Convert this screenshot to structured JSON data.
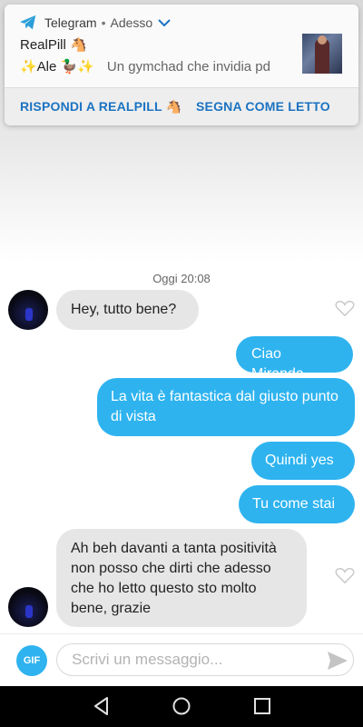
{
  "notification": {
    "app": "Telegram",
    "separator": "•",
    "time": "Adesso",
    "title": "RealPill 🐴",
    "sender": "✨Ale 🦆✨",
    "preview": "Un gymchad che invidia pd",
    "actions": [
      "RISPONDI A REALPILL 🐴",
      "SEGNA COME LETTO"
    ]
  },
  "chat": {
    "date": "Oggi 20:08",
    "messages": [
      {
        "dir": "in",
        "text": "Hey, tutto bene?"
      },
      {
        "dir": "out",
        "text": "Ciao Miranda"
      },
      {
        "dir": "out",
        "text": "La vita è fantastica dal giusto punto di vista"
      },
      {
        "dir": "out",
        "text": "Quindi yes"
      },
      {
        "dir": "out",
        "text": "Tu come stai"
      },
      {
        "dir": "in",
        "text": "Ah beh davanti a tanta positività non posso che dirti che adesso che ho letto questo sto molto bene, grazie"
      }
    ]
  },
  "input": {
    "gif_label": "GIF",
    "placeholder": "Scrivi un messaggio..."
  },
  "colors": {
    "accent": "#2eb3ef",
    "incoming_bubble": "#e6e6e6",
    "action_text": "#1a73c2"
  },
  "icons": [
    "telegram-icon",
    "chevron-down-icon",
    "heart-icon",
    "send-icon",
    "back-icon",
    "home-icon",
    "recents-icon"
  ]
}
